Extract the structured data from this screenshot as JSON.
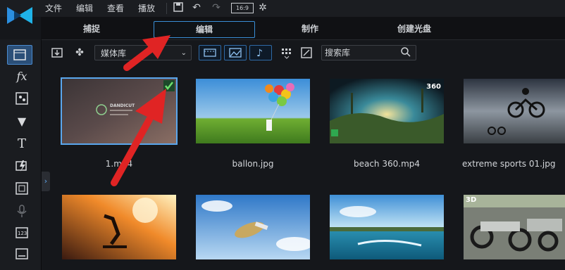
{
  "menu": {
    "file": "文件",
    "edit": "编辑",
    "view": "查看",
    "playback": "播放",
    "ratio": "16:9"
  },
  "mode_tabs": {
    "capture": "捕捉",
    "edit": "编辑",
    "produce": "制作",
    "create_disc": "创建光盘"
  },
  "library": {
    "media_select": "媒体库",
    "search_placeholder": "搜索库"
  },
  "thumbnails": [
    {
      "label": "1.mp4",
      "badge": "",
      "selected": true,
      "overlay": "DANDICUT"
    },
    {
      "label": "ballon.jpg",
      "badge": ""
    },
    {
      "label": "beach 360.mp4",
      "badge": "360"
    },
    {
      "label": "extreme sports 01.jpg",
      "badge": ""
    },
    {
      "label": "",
      "badge": ""
    },
    {
      "label": "",
      "badge": ""
    },
    {
      "label": "",
      "badge": ""
    },
    {
      "label": "",
      "badge": "3D"
    }
  ],
  "colors": {
    "accent": "#3a8fd6",
    "arrow": "#e02424",
    "selection": "#5aa7ee"
  }
}
